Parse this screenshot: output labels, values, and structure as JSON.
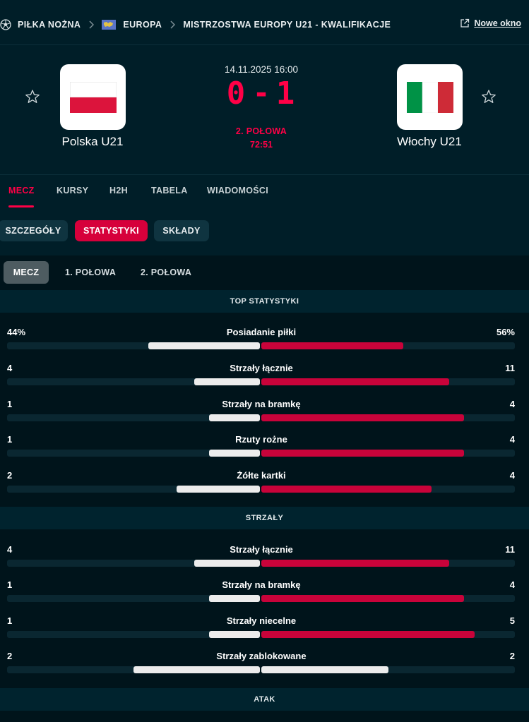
{
  "breadcrumb": {
    "sport": "PIŁKA NOŻNA",
    "region": "EUROPA",
    "competition": "MISTRZOSTWA EUROPY U21 - KWALIFIKACJE"
  },
  "new_window_label": "Nowe okno",
  "match": {
    "datetime": "14.11.2025 16:00",
    "home_team": "Polska U21",
    "away_team": "Włochy U21",
    "home_score": "0",
    "away_score": "1",
    "score_separator": "-",
    "status": "2. POŁOWA",
    "minute": "72:51"
  },
  "tabs": [
    "MECZ",
    "KURSY",
    "H2H",
    "TABELA",
    "WIADOMOŚCI"
  ],
  "subtabs": [
    "SZCZEGÓŁY",
    "STATYSTYKI",
    "SKŁADY"
  ],
  "periods": [
    "MECZ",
    "1. POŁOWA",
    "2. POŁOWA"
  ],
  "sections": [
    {
      "title": "TOP STATYSTYKI",
      "stats": [
        {
          "label": "Posiadanie piłki",
          "home": "44%",
          "away": "56%"
        },
        {
          "label": "Strzały łącznie",
          "home": "4",
          "away": "11"
        },
        {
          "label": "Strzały na bramkę",
          "home": "1",
          "away": "4"
        },
        {
          "label": "Rzuty rożne",
          "home": "1",
          "away": "4"
        },
        {
          "label": "Żółte kartki",
          "home": "2",
          "away": "4"
        }
      ]
    },
    {
      "title": "STRZAŁY",
      "stats": [
        {
          "label": "Strzały łącznie",
          "home": "4",
          "away": "11"
        },
        {
          "label": "Strzały na bramkę",
          "home": "1",
          "away": "4"
        },
        {
          "label": "Strzały niecelne",
          "home": "1",
          "away": "5"
        },
        {
          "label": "Strzały zablokowane",
          "home": "2",
          "away": "2"
        }
      ]
    },
    {
      "title": "ATAK",
      "stats": []
    }
  ],
  "bar_fractions": {
    "top": [
      [
        0.44,
        0.56
      ],
      [
        0.26,
        0.74
      ],
      [
        0.2,
        0.8
      ],
      [
        0.2,
        0.8
      ],
      [
        0.33,
        0.67
      ]
    ],
    "shots": [
      [
        0.26,
        0.74
      ],
      [
        0.2,
        0.8
      ],
      [
        0.2,
        0.84
      ],
      [
        0.5,
        0.5
      ]
    ]
  },
  "colors": {
    "accent": "#ff0046",
    "away_bar": "#c8033a",
    "home_bar": "#ececec",
    "background": "#001e28"
  },
  "icons": {
    "sport": "soccer-ball-icon",
    "region": "europe-flag-icon",
    "separator": "chevron-right-icon",
    "new_window": "external-link-icon",
    "favorite": "star-outline-icon"
  }
}
